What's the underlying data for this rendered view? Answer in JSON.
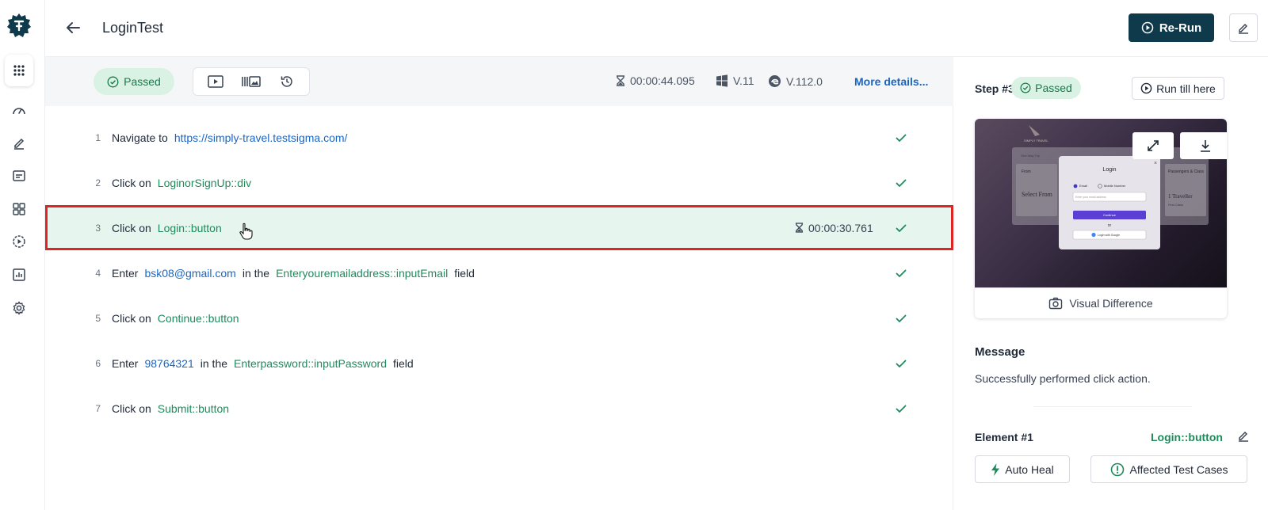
{
  "header": {
    "title": "LoginTest",
    "rerun_label": "Re-Run"
  },
  "toolbar": {
    "status": "Passed",
    "duration": "00:00:44.095",
    "os_version": "V.11",
    "browser_version": "V.112.0",
    "more_details": "More details..."
  },
  "steps": [
    {
      "num": "1",
      "parts": [
        [
          "kw",
          "Navigate to"
        ],
        [
          "lnk",
          "https://simply-travel.testsigma.com/"
        ]
      ]
    },
    {
      "num": "2",
      "parts": [
        [
          "kw",
          "Click on"
        ],
        [
          "el",
          "LoginorSignUp::div"
        ]
      ]
    },
    {
      "num": "3",
      "parts": [
        [
          "kw",
          "Click on"
        ],
        [
          "el",
          "Login::button"
        ]
      ],
      "duration": "00:00:30.761",
      "highlight": true
    },
    {
      "num": "4",
      "parts": [
        [
          "kw",
          "Enter"
        ],
        [
          "lnk",
          "bsk08@gmail.com"
        ],
        [
          "txt",
          "in the"
        ],
        [
          "el",
          "Enteryouremailaddress::inputEmail"
        ],
        [
          "txt",
          "field"
        ]
      ]
    },
    {
      "num": "5",
      "parts": [
        [
          "kw",
          "Click on"
        ],
        [
          "el",
          "Continue::button"
        ]
      ]
    },
    {
      "num": "6",
      "parts": [
        [
          "kw",
          "Enter"
        ],
        [
          "lnk",
          "98764321"
        ],
        [
          "txt",
          "in the"
        ],
        [
          "el",
          "Enterpassword::inputPassword"
        ],
        [
          "txt",
          "field"
        ]
      ]
    },
    {
      "num": "7",
      "parts": [
        [
          "kw",
          "Click on"
        ],
        [
          "el",
          "Submit::button"
        ]
      ]
    }
  ],
  "panel": {
    "step_title": "Step #3",
    "status": "Passed",
    "run_till_here": "Run till here",
    "visual_difference": "Visual Difference",
    "message_label": "Message",
    "message_text": "Successfully performed click action.",
    "element_label": "Element #1",
    "element_name": "Login::button",
    "auto_heal": "Auto Heal",
    "affected": "Affected Test Cases"
  },
  "screenshot_preview": {
    "brand": "SIMPLY TRAVEL",
    "modal_title": "Login",
    "radio_email": "Email",
    "radio_mobile": "Mobile Number",
    "input_placeholder": "Enter your email address",
    "continue": "Continue",
    "or": "or",
    "google": "Login with Google",
    "left_card_title": "From",
    "left_card_text": "Select From",
    "right_card_title": "Passengers & Class",
    "right_card_text": "1 Traveller",
    "right_card_sub": "First Class",
    "tab_one_way": "One Way Trip"
  },
  "colors": {
    "primary_button": "#0e3a4c",
    "success": "#1f8a5c",
    "link": "#1a66c4",
    "highlight_border": "#e02323"
  }
}
